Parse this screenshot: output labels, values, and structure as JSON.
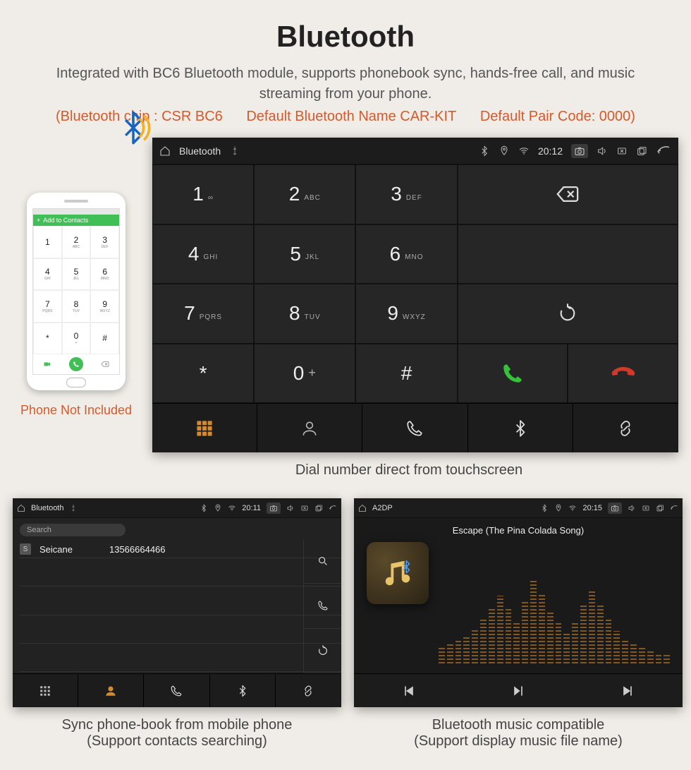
{
  "title": "Bluetooth",
  "subtitle": "Integrated with BC6 Bluetooth module, supports phonebook sync, hands-free call, and music streaming from your phone.",
  "specs": {
    "chip": "(Bluetooth chip : CSR BC6",
    "name": "Default Bluetooth Name CAR-KIT",
    "pair": "Default Pair Code: 0000)"
  },
  "phone": {
    "bar_label": "Add to Contacts",
    "keys": [
      {
        "d": "1",
        "s": ""
      },
      {
        "d": "2",
        "s": "ABC"
      },
      {
        "d": "3",
        "s": "DEF"
      },
      {
        "d": "4",
        "s": "GHI"
      },
      {
        "d": "5",
        "s": "JKL"
      },
      {
        "d": "6",
        "s": "MNO"
      },
      {
        "d": "7",
        "s": "PQRS"
      },
      {
        "d": "8",
        "s": "TUV"
      },
      {
        "d": "9",
        "s": "WXYZ"
      },
      {
        "d": "*",
        "s": ""
      },
      {
        "d": "0",
        "s": "+"
      },
      {
        "d": "#",
        "s": ""
      }
    ],
    "caption": "Phone Not Included"
  },
  "dialer": {
    "topbar_title": "Bluetooth",
    "time": "20:12",
    "keys": [
      {
        "d": "1",
        "s": "∞"
      },
      {
        "d": "2",
        "s": "ABC"
      },
      {
        "d": "3",
        "s": "DEF"
      },
      {
        "d": "4",
        "s": "GHI"
      },
      {
        "d": "5",
        "s": "JKL"
      },
      {
        "d": "6",
        "s": "MNO"
      },
      {
        "d": "7",
        "s": "PQRS"
      },
      {
        "d": "8",
        "s": "TUV"
      },
      {
        "d": "9",
        "s": "WXYZ"
      },
      {
        "d": "*",
        "s": ""
      },
      {
        "d": "0",
        "s": "+"
      },
      {
        "d": "#",
        "s": ""
      }
    ],
    "caption": "Dial number direct from touchscreen"
  },
  "phonebook": {
    "topbar_title": "Bluetooth",
    "time": "20:11",
    "search_placeholder": "Search",
    "contact_badge": "S",
    "contact_name": "Seicane",
    "contact_number": "13566664466",
    "caption_line1": "Sync phone-book from mobile phone",
    "caption_line2": "(Support contacts searching)"
  },
  "a2dp": {
    "topbar_title": "A2DP",
    "time": "20:15",
    "song": "Escape (The Pina Colada Song)",
    "caption_line1": "Bluetooth music compatible",
    "caption_line2": "(Support display music file name)"
  }
}
